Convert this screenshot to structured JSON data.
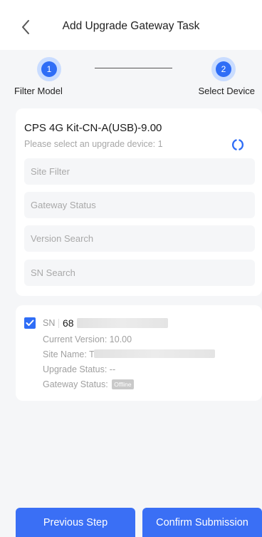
{
  "header": {
    "title": "Add Upgrade Gateway Task"
  },
  "steps": [
    {
      "number": "1",
      "label": "Filter Model"
    },
    {
      "number": "2",
      "label": "Select Device"
    }
  ],
  "model_card": {
    "title": "CPS 4G Kit-CN-A(USB)-9.00",
    "hint": "Please select an upgrade device: 1",
    "filters": {
      "site": "Site Filter",
      "gateway_status": "Gateway Status",
      "version": "Version Search",
      "sn": "SN Search"
    }
  },
  "device": {
    "sn_label": "SN",
    "sn_value": "68",
    "current_version": "Current Version: 10.00",
    "site_name": "Site Name: T",
    "upgrade_status": "Upgrade Status: --",
    "gateway_status_label": "Gateway Status:",
    "gateway_status_badge": "Offline",
    "checked": true
  },
  "buttons": {
    "previous": "Previous Step",
    "confirm": "Confirm Submission"
  },
  "colors": {
    "accent": "#2f6df6",
    "button": "#3a6ff5",
    "background": "#f5f6f8"
  }
}
